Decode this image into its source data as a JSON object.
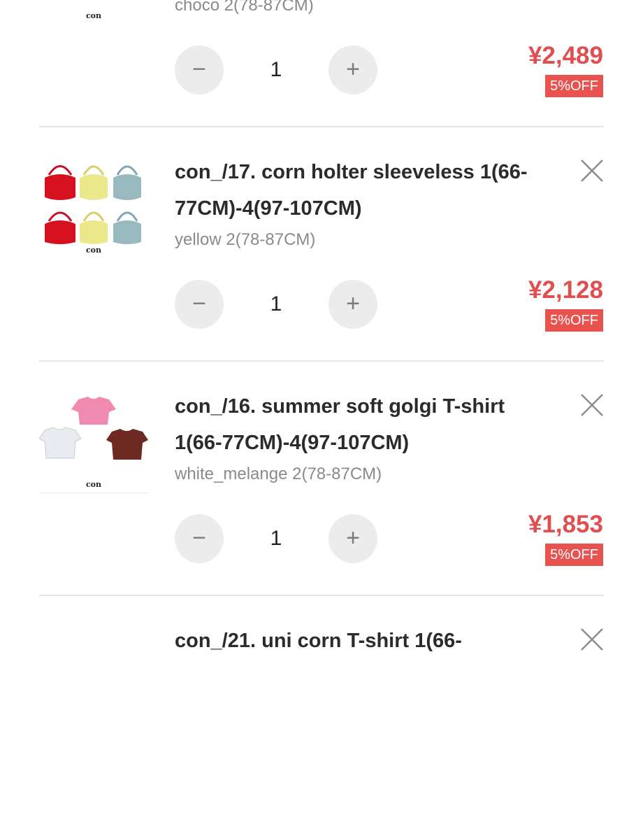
{
  "cart": {
    "items": [
      {
        "title": "",
        "variant": "choco 2(78-87CM)",
        "quantity": "1",
        "price": "¥2,489",
        "discount": "5%OFF",
        "thumb_brand": "con",
        "minus_icon": "minus-icon",
        "plus_icon": "plus-icon",
        "remove_icon": "close-icon"
      },
      {
        "title": "con_/17. corn holter sleeveless 1(66-\n77CM)-4(97-107CM)",
        "variant": "yellow 2(78-87CM)",
        "quantity": "1",
        "price": "¥2,128",
        "discount": "5%OFF",
        "thumb_brand": "con",
        "minus_icon": "minus-icon",
        "plus_icon": "plus-icon",
        "remove_icon": "close-icon"
      },
      {
        "title": "con_/16. summer soft golgi T-shirt\n1(66-77CM)-4(97-107CM)",
        "variant": "white_melange 2(78-87CM)",
        "quantity": "1",
        "price": "¥1,853",
        "discount": "5%OFF",
        "thumb_brand": "con",
        "minus_icon": "minus-icon",
        "plus_icon": "plus-icon",
        "remove_icon": "close-icon"
      },
      {
        "title": "con_/21. uni corn T-shirt 1(66-",
        "remove_icon": "close-icon"
      }
    ]
  },
  "colors": {
    "price": "#e04f4f",
    "badge_bg": "#e8534f",
    "qty_button_bg": "#ececec",
    "divider": "#e6e6e6"
  }
}
